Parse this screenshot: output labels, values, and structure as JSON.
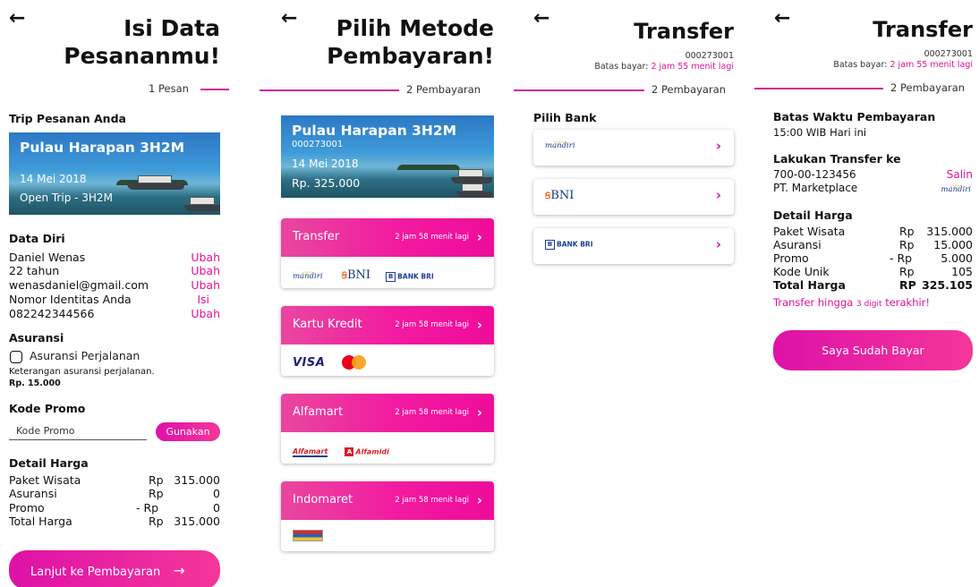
{
  "screen1": {
    "title_line1": "Isi Data",
    "title_line2": "Pesananmu!",
    "step_label": "1 Pesan",
    "trip_heading": "Trip Pesanan Anda",
    "trip": {
      "name": "Pulau Harapan 3H2M",
      "date": "14 Mei 2018",
      "type": "Open Trip - 3H2M"
    },
    "data_heading": "Data Diri",
    "data_rows": [
      {
        "value": "Daniel Wenas",
        "action": "Ubah"
      },
      {
        "value": "22 tahun",
        "action": "Ubah"
      },
      {
        "value": "wenasdaniel@gmail.com",
        "action": "Ubah"
      },
      {
        "value": "Nomor Identitas Anda",
        "action": "Isi"
      },
      {
        "value": "082242344566",
        "action": "Ubah"
      }
    ],
    "insurance_heading": "Asuransi",
    "insurance_option": "Asuransi Perjalanan",
    "insurance_desc": "Keterangan asuransi perjalanan.",
    "insurance_price": "Rp. 15.000",
    "insurance_checked": false,
    "promo_heading": "Kode Promo",
    "promo_placeholder": "Kode Promo",
    "promo_button": "Gunakan",
    "price_heading": "Detail Harga",
    "prices": [
      {
        "label": "Paket Wisata",
        "cur": "Rp",
        "value": "315.000"
      },
      {
        "label": "Asuransi",
        "cur": "Rp",
        "value": "0"
      },
      {
        "label": "Promo",
        "cur": "- Rp",
        "value": "0"
      },
      {
        "label": "Total Harga",
        "cur": "Rp",
        "value": "315.000"
      }
    ],
    "cta_label": "Lanjut ke Pembayaran",
    "cta_arrow": "→"
  },
  "screen2": {
    "title_line1": "Pilih Metode",
    "title_line2": "Pembayaran!",
    "step_label": "2 Pembayaran",
    "trip": {
      "name": "Pulau Harapan 3H2M",
      "code": "000273001",
      "date": "14 Mei 2018",
      "price": "Rp. 325.000"
    },
    "methods": [
      {
        "name": "Transfer",
        "time_left": "2 jam 58 menit lagi"
      },
      {
        "name": "Kartu Kredit",
        "time_left": "2 jam 58 menit lagi"
      },
      {
        "name": "Alfamart",
        "time_left": "2 jam 58 menit lagi"
      },
      {
        "name": "Indomaret",
        "time_left": "2 jam 58 menit lagi"
      }
    ],
    "logos": {
      "mandiri": "mandiri",
      "bni": "BNI",
      "bri": "BANK BRI",
      "visa": "VISA",
      "alfamart": "Alfamart",
      "alfamidi": "Alfamidi"
    }
  },
  "screen3": {
    "title": "Transfer",
    "order_code": "000273001",
    "deadline_label": "Batas bayar:",
    "deadline_value": "2 jam 55 menit lagi",
    "step_label": "2 Pembayaran",
    "bank_heading": "Pilih Bank",
    "banks": [
      "mandiri",
      "BNI",
      "BANK BRI"
    ]
  },
  "screen4": {
    "title": "Transfer",
    "order_code": "000273001",
    "deadline_label": "Batas bayar:",
    "deadline_value": "2 jam 55 menit lagi",
    "step_label": "2 Pembayaran",
    "time_heading": "Batas Waktu Pembayaran",
    "time_value": "15:00 WIB Hari ini",
    "transfer_heading": "Lakukan Transfer ke",
    "account_number": "700-00-123456",
    "copy_label": "Salin",
    "account_name": "PT. Marketplace",
    "bank_logo": "mandiri",
    "price_heading": "Detail Harga",
    "prices": [
      {
        "label": "Paket Wisata",
        "cur": "Rp",
        "value": "315.000"
      },
      {
        "label": "Asuransi",
        "cur": "Rp",
        "value": "15.000"
      },
      {
        "label": "Promo",
        "cur": "- Rp",
        "value": "5.000"
      },
      {
        "label": "Kode Unik",
        "cur": "Rp",
        "value": "105"
      },
      {
        "label": "Total Harga",
        "cur": "RP",
        "value": "325.105"
      }
    ],
    "hint_prefix": "Transfer hingga",
    "hint_mid": "3 digit",
    "hint_suffix": "terakhir!",
    "cta_label": "Saya Sudah Bayar"
  },
  "colors": {
    "accent": "#e0119a",
    "gradient_start": "#de11a8",
    "gradient_end": "#f5369a",
    "bank_blue": "#1c3f91"
  },
  "icons": {
    "back": "←",
    "chevron": "›"
  }
}
